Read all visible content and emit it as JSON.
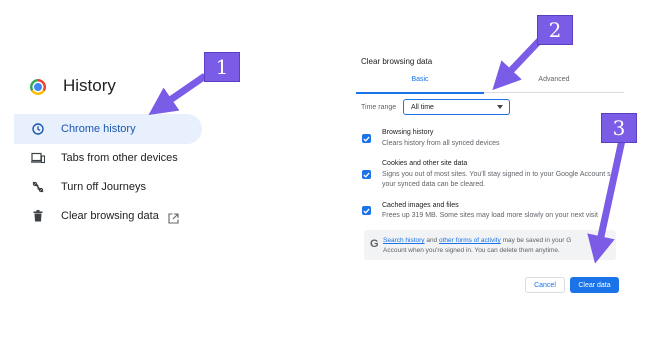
{
  "sidebar": {
    "title": "History",
    "items": [
      {
        "label": "Chrome history",
        "icon": "clock-icon"
      },
      {
        "label": "Tabs from other devices",
        "icon": "devices-icon"
      },
      {
        "label": "Turn off Journeys",
        "icon": "journeys-off-icon"
      },
      {
        "label": "Clear browsing data",
        "icon": "trash-icon"
      }
    ]
  },
  "dialog": {
    "title": "Clear browsing data",
    "tabs": [
      "Basic",
      "Advanced"
    ],
    "time_range_label": "Time range",
    "time_range_value": "All time",
    "options": [
      {
        "title": "Browsing history",
        "desc": [
          "Clears history from all synced devices"
        ]
      },
      {
        "title": "Cookies and other site data",
        "desc": [
          "Signs you out of most sites. You'll stay signed in to your Google Account s",
          "your synced data can be cleared."
        ]
      },
      {
        "title": "Cached images and files",
        "desc": [
          "Frees up 319 MB. Some sites may load more slowly on your next visit"
        ]
      }
    ],
    "info": {
      "link1": "Search history",
      "and": " and ",
      "link2": "other forms of activity",
      "rest1": " may be saved in your G",
      "line2": "Account when you're signed in. You can delete them anytime."
    },
    "cancel_label": "Cancel",
    "clear_label": "Clear data"
  },
  "callouts": [
    "1",
    "2",
    "3"
  ],
  "colors": {
    "accent": "#1a73e8",
    "callout": "#7b5ce6",
    "active_bg": "#e8f0fe"
  }
}
